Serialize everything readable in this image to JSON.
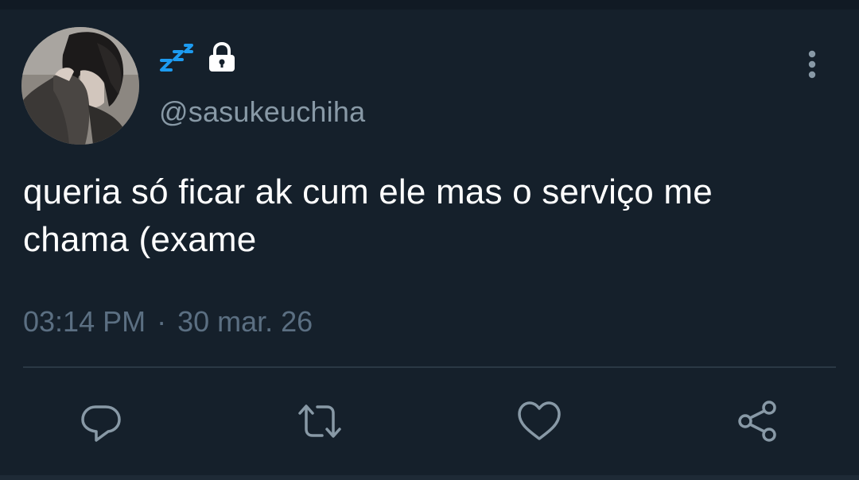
{
  "tweet": {
    "handle": "@sasukeuchiha",
    "name_icons": [
      "zzz-icon",
      "lock-icon"
    ],
    "text": "queria só ficar ak cum ele mas o serviço me\nchama (exame",
    "time": "03:14 PM",
    "separator": "·",
    "date": "30 mar. 26"
  },
  "actions": [
    "reply-icon",
    "retweet-icon",
    "like-icon",
    "share-icon"
  ],
  "colors": {
    "background": "#15202b",
    "text": "#ffffff",
    "secondary": "#8899a6",
    "icon": "#8899a6",
    "zzz": "#1d9bf0"
  }
}
